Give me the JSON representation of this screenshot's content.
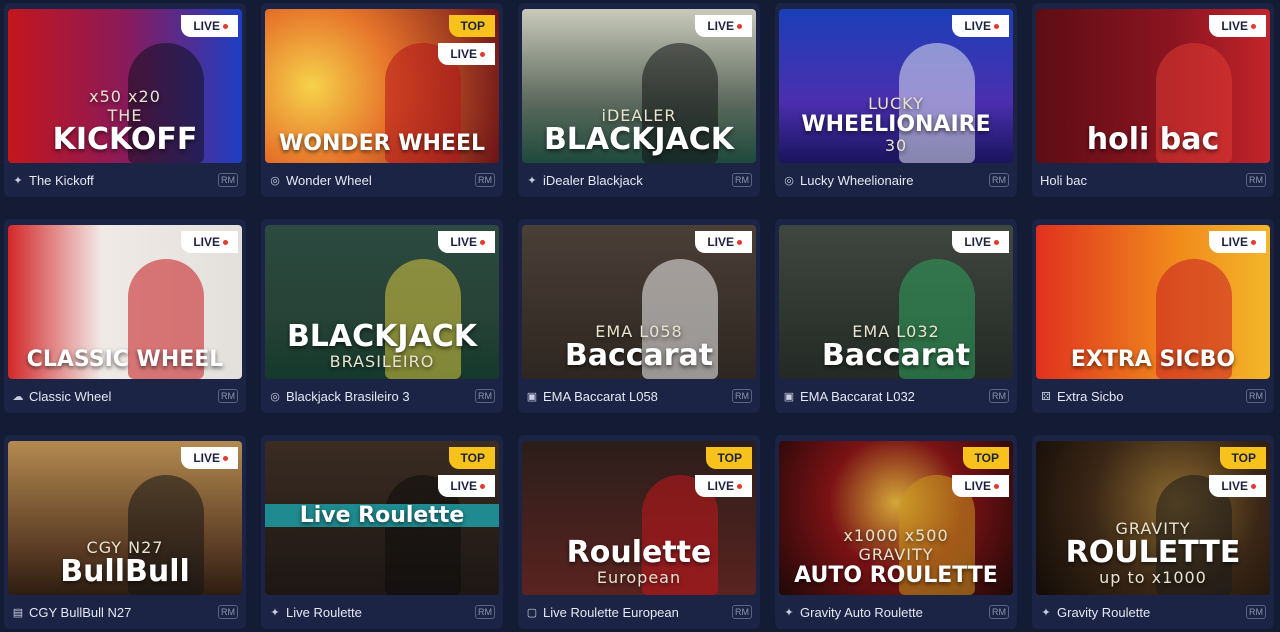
{
  "colors": {
    "background": "#131b35",
    "card": "#1b2444",
    "live_badge": "#ffffff",
    "top_badge": "#f7c21b"
  },
  "games": [
    {
      "name": "The Kickoff",
      "icon": "sparkle-icon",
      "badges": [
        "LIVE"
      ],
      "art_sub": "THE",
      "art_main": "KICKOFF",
      "art_extra": "x50  x20",
      "bg": "linear-gradient(90deg,#c4161c 0%,#8a1a5a 50%,#1d3fc4 100%)",
      "fig": "#0e0f1d"
    },
    {
      "name": "Wonder Wheel",
      "icon": "wheel-icon",
      "badges": [
        "TOP",
        "LIVE"
      ],
      "art_sub": "",
      "art_main": "WONDER WHEEL",
      "art_extra": "",
      "bg": "radial-gradient(circle at 20% 50%,#f6d24a 0%,#e6742b 40%,#6b1218 100%)",
      "fig": "#b2141c"
    },
    {
      "name": "iDealer Blackjack",
      "icon": "sparkle-icon",
      "badges": [
        "LIVE"
      ],
      "art_sub": "iDEALER",
      "art_main": "BLACKJACK",
      "art_extra": "",
      "bg": "linear-gradient(180deg,#c9cabb 0%,#5d6a5d 60%,#1d4a3c 100%)",
      "fig": "#121214"
    },
    {
      "name": "Lucky Wheelionaire",
      "icon": "wheel-icon",
      "badges": [
        "LIVE"
      ],
      "art_sub": "LUCKY",
      "art_main": "WHEELIONAIRE",
      "art_extra": "30",
      "bg": "linear-gradient(180deg,#1b3fb8 0%,#4b2fb0 60%,#1a145d 100%)",
      "fig": "#dfe3ef"
    },
    {
      "name": "Holi bac",
      "icon": "",
      "badges": [
        "LIVE"
      ],
      "art_sub": "",
      "art_main": "holi bac",
      "art_extra": "",
      "bg": "linear-gradient(90deg,#5d0d14 0%,#8c1521 60%,#c4242b 100%)",
      "fig": "#e13a33"
    },
    {
      "name": "Classic Wheel",
      "icon": "cloud-icon",
      "badges": [
        "LIVE"
      ],
      "art_sub": "",
      "art_main": "CLASSIC WHEEL",
      "art_extra": "",
      "bg": "linear-gradient(90deg,#d3282a 0%,#f0eae6 40%,#e3e0dc 100%)",
      "fig": "#c4161c"
    },
    {
      "name": "Blackjack Brasileiro 3",
      "icon": "wheel-icon",
      "badges": [
        "LIVE"
      ],
      "art_sub": "",
      "art_main": "BLACKJACK",
      "art_extra": "BRASILEIRO",
      "bg": "linear-gradient(180deg,#2c4a40 0%,#274236 60%,#14392c 100%)",
      "fig": "#d9c93f"
    },
    {
      "name": "EMA Baccarat L058",
      "icon": "ema-icon",
      "badges": [
        "LIVE"
      ],
      "art_sub": "EMA              L058",
      "art_main": "Baccarat",
      "art_extra": "",
      "bg": "linear-gradient(180deg,#4a3f37 0%,#2e2620 100%)",
      "fig": "#f2f2f2"
    },
    {
      "name": "EMA Baccarat L032",
      "icon": "ema-icon",
      "badges": [
        "LIVE"
      ],
      "art_sub": "EMA              L032",
      "art_main": "Baccarat",
      "art_extra": "",
      "bg": "linear-gradient(180deg,#3f4740 0%,#232a25 100%)",
      "fig": "#2fa35c"
    },
    {
      "name": "Extra Sicbo",
      "icon": "dice-icon",
      "badges": [
        "LIVE"
      ],
      "art_sub": "",
      "art_main": "EXTRA SICBO",
      "art_extra": "",
      "bg": "linear-gradient(90deg,#e0311f 0%,#f08a1c 60%,#f3b62a 100%)",
      "fig": "#c81c24"
    },
    {
      "name": "CGY BullBull N27",
      "icon": "cgy-icon",
      "badges": [
        "LIVE"
      ],
      "art_sub": "CGY              N27",
      "art_main": "BullBull",
      "art_extra": "",
      "bg": "linear-gradient(180deg,#b38a50 0%,#5b3c24 70%,#2d1d12 100%)",
      "fig": "#141414"
    },
    {
      "name": "Live Roulette",
      "icon": "sparkle-icon",
      "badges": [
        "TOP",
        "LIVE"
      ],
      "art_sub": "Live Roulette",
      "art_main": "",
      "art_extra": "",
      "bg": "linear-gradient(180deg,#3a2c22 0%,#1d1613 100%)",
      "fig": "#0c0c0c"
    },
    {
      "name": "Live Roulette European",
      "icon": "square-icon",
      "badges": [
        "TOP",
        "LIVE"
      ],
      "art_sub": "",
      "art_main": "Roulette",
      "art_extra": "European",
      "bg": "linear-gradient(180deg,#2b1e1a 0%,#5a2320 100%)",
      "fig": "#c4161c"
    },
    {
      "name": "Gravity Auto Roulette",
      "icon": "sparkle-icon",
      "badges": [
        "TOP",
        "LIVE"
      ],
      "art_sub": "GRAVITY",
      "art_main": "AUTO ROULETTE",
      "art_extra": "x1000  x500",
      "bg": "radial-gradient(circle at 50% 40%,#d4a738 0%,#7a1215 45%,#1e0808 100%)",
      "fig": "#c9981e"
    },
    {
      "name": "Gravity Roulette",
      "icon": "sparkle-icon",
      "badges": [
        "TOP",
        "LIVE"
      ],
      "art_sub": "GRAVITY",
      "art_main": "ROULETTE",
      "art_extra": "up to x1000",
      "bg": "radial-gradient(circle at 60% 40%,#8c6a2e 0%,#3a2716 50%,#120c08 100%)",
      "fig": "#1a1a1a"
    }
  ],
  "provider_tag": "RM"
}
